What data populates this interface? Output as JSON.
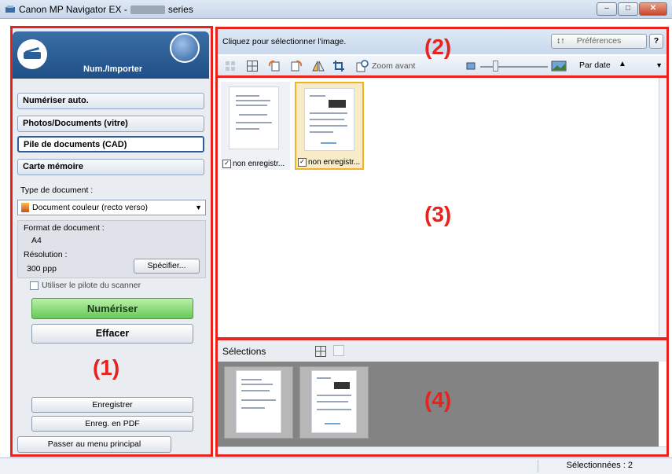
{
  "window": {
    "title_prefix": "Canon MP Navigator EX -",
    "title_suffix": "series",
    "minimize": "–",
    "maximize": "□",
    "close": "✕"
  },
  "left_panel": {
    "header_label": "Num./Importer",
    "menu": [
      {
        "label": "Numériser auto."
      },
      {
        "label": "Photos/Documents (vitre)"
      },
      {
        "label": "Pile de documents (CAD)"
      },
      {
        "label": "Carte mémoire"
      }
    ],
    "doc_type_label": "Type de document :",
    "doc_type_value": "Document couleur (recto verso)",
    "format_label": "Format de document :",
    "format_value": "A4",
    "resolution_label": "Résolution :",
    "resolution_value": "300 ppp",
    "specify_button": "Spécifier...",
    "driver_checkbox_label": "Utiliser le pilote du scanner",
    "scan_button": "Numériser",
    "clear_button": "Effacer",
    "save_button": "Enregistrer",
    "save_pdf_button": "Enreg. en PDF",
    "main_menu_button": "Passer au menu principal"
  },
  "toolbar": {
    "hint": "Cliquez pour sélectionner l'image.",
    "preferences_button": "Préférences",
    "help_button": "?",
    "zoom_label": "Zoom avant",
    "sort_value": "Par date",
    "sort_arrow": "▲"
  },
  "thumbnails": [
    {
      "caption": "non enregistr...",
      "checked": true,
      "selected": false
    },
    {
      "caption": "non enregistr...",
      "checked": true,
      "selected": true
    }
  ],
  "selections": {
    "label": "Sélections"
  },
  "status": {
    "selected_text": "Sélectionnées : 2"
  },
  "area_labels": [
    "(1)",
    "(2)",
    "(3)",
    "(4)"
  ],
  "colors": {
    "highlight_red": "#e8221c",
    "scan_green": "#69c858",
    "selected_thumb": "#f0b323"
  }
}
